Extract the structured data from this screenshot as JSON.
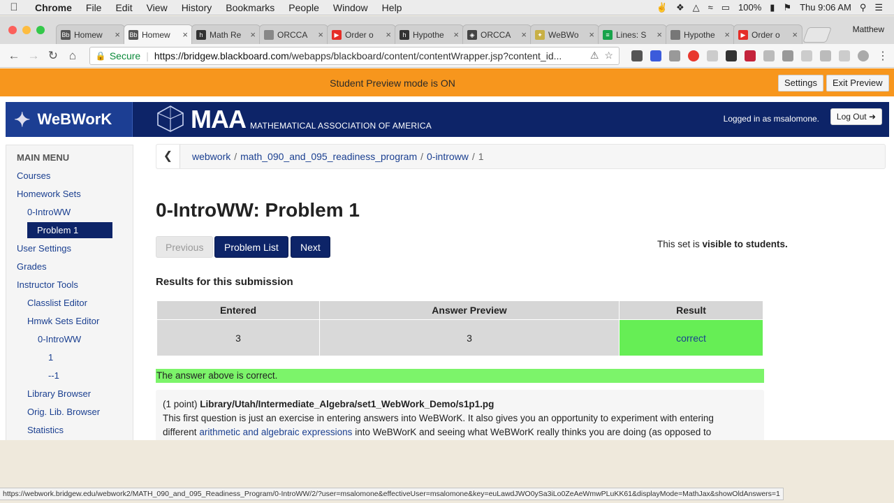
{
  "menubar": {
    "app": "Chrome",
    "items": [
      "File",
      "Edit",
      "View",
      "History",
      "Bookmarks",
      "People",
      "Window",
      "Help"
    ],
    "battery": "100%",
    "clock": "Thu 9:06 AM"
  },
  "tabs": [
    {
      "label": "Homew",
      "icon_color": "#555555",
      "icon": "Bb",
      "active": false
    },
    {
      "label": "Homew",
      "icon_color": "#555555",
      "icon": "Bb",
      "active": true
    },
    {
      "label": "Math Re",
      "icon_color": "#333333",
      "icon": "h",
      "active": false
    },
    {
      "label": "ORCCA",
      "icon_color": "#888888",
      "icon": "",
      "active": false
    },
    {
      "label": "Order o",
      "icon_color": "#e52d27",
      "icon": "▶",
      "active": false
    },
    {
      "label": "Hypothe",
      "icon_color": "#333333",
      "icon": "h",
      "active": false
    },
    {
      "label": "ORCCA",
      "icon_color": "#444444",
      "icon": "◈",
      "active": false
    },
    {
      "label": "WeBWo",
      "icon_color": "#c8b046",
      "icon": "✦",
      "active": false
    },
    {
      "label": "Lines: S",
      "icon_color": "#17a34a",
      "icon": "≡",
      "active": false
    },
    {
      "label": "Hypothe",
      "icon_color": "#777777",
      "icon": "",
      "active": false
    },
    {
      "label": "Order o",
      "icon_color": "#e52d27",
      "icon": "▶",
      "active": false
    }
  ],
  "profile_name": "Matthew",
  "omnibox": {
    "secure_label": "Secure",
    "url_host": "https://bridgew.blackboard.com",
    "url_path": "/webapps/blackboard/content/contentWrapper.jsp?content_id..."
  },
  "preview": {
    "message": "Student Preview mode is ON",
    "settings_label": "Settings",
    "exit_label": "Exit Preview"
  },
  "header": {
    "brand": "WeBWorK",
    "maa_big": "MAA",
    "maa_small": "MATHEMATICAL ASSOCIATION OF AMERICA",
    "login_text": "Logged in as msalomone.",
    "logout_label": "Log Out"
  },
  "sidebar": {
    "heading": "MAIN MENU",
    "items": [
      {
        "label": "Courses"
      },
      {
        "label": "Homework Sets"
      },
      {
        "label": "0-IntroWW"
      },
      {
        "label": "Problem 1"
      },
      {
        "label": "User Settings"
      },
      {
        "label": "Grades"
      },
      {
        "label": "Instructor Tools"
      },
      {
        "label": "Classlist Editor"
      },
      {
        "label": "Hmwk Sets Editor"
      },
      {
        "label": "0-IntroWW"
      },
      {
        "label": "1"
      },
      {
        "label": "--1"
      },
      {
        "label": "Library Browser"
      },
      {
        "label": "Orig. Lib. Browser"
      },
      {
        "label": "Statistics"
      }
    ]
  },
  "breadcrumb": {
    "items": [
      "webwork",
      "math_090_and_095_readiness_program",
      "0-introww",
      "1"
    ]
  },
  "page": {
    "title": "0-IntroWW: Problem 1",
    "prev_label": "Previous",
    "problem_list_label": "Problem List",
    "next_label": "Next",
    "visibility_prefix": "This set is",
    "visibility_value": "visible to students."
  },
  "results": {
    "heading": "Results for this submission",
    "columns": [
      "Entered",
      "Answer Preview",
      "Result"
    ],
    "row": {
      "entered": "3",
      "preview": "3",
      "result": "correct"
    },
    "status_message": "The answer above is correct."
  },
  "problem": {
    "points": "(1 point)",
    "path": "Library/Utah/Intermediate_Algebra/set1_WebWork_Demo/s1p1.pg",
    "line1": "This first question is just an exercise in entering answers into WeBWorK. It also gives you an opportunity to experiment with entering",
    "line2_pre": "different",
    "line2_link": "arithmetic and algebraic expressions",
    "line2_post": "into WeBWorK and seeing what WeBWorK really thinks you are doing (as opposed to"
  },
  "statusbar": {
    "url": "https://webwork.bridgew.edu/webwork2/MATH_090_and_095_Readiness_Program/0-IntroWW/2/?user=msalomone&effectiveUser=msalomone&key=euLawdJWO0ySa3iLo0ZeAeWmwPLuKK61&displayMode=MathJax&showOldAnswers=1"
  },
  "colors": {
    "accent_navy": "#0d2468",
    "preview_orange": "#f7961d",
    "correct_green": "#66ee55"
  }
}
